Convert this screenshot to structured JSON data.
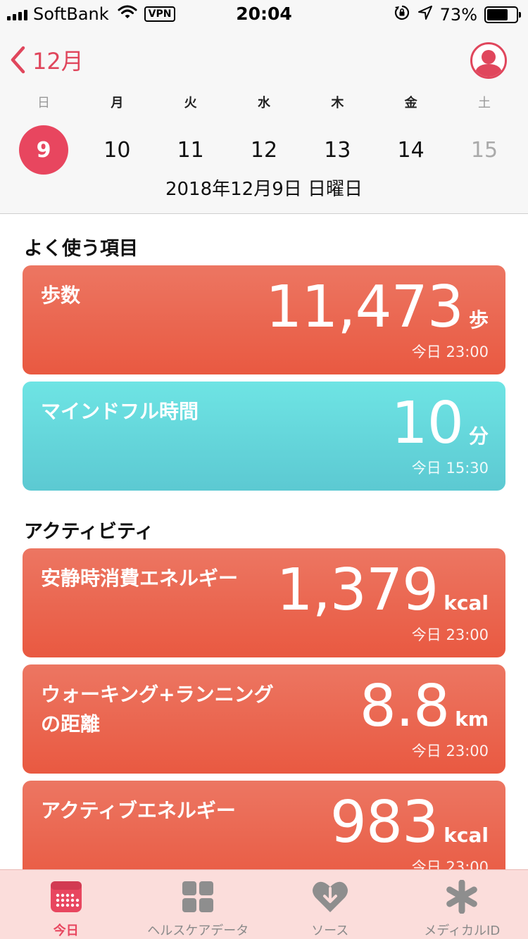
{
  "status_bar": {
    "carrier": "SoftBank",
    "vpn": "VPN",
    "time": "20:04",
    "battery": "73%",
    "battery_level": 0.73
  },
  "header": {
    "back_label": "12月",
    "weekdays": [
      "日",
      "月",
      "火",
      "水",
      "木",
      "金",
      "土"
    ],
    "dates": [
      "9",
      "10",
      "11",
      "12",
      "13",
      "14",
      "15"
    ],
    "selected_date": "9",
    "full_date": "2018年12月9日 日曜日"
  },
  "favorites": {
    "title": "よく使う項目",
    "cards": [
      {
        "title": "歩数",
        "value": "11,473",
        "unit": "歩",
        "timestamp": "今日 23:00",
        "color": "#ea6450"
      },
      {
        "title": "マインドフル時間",
        "value": "10",
        "unit": "分",
        "timestamp": "今日 15:30",
        "color": "#66d8dd"
      }
    ]
  },
  "activity": {
    "title": "アクティビティ",
    "cards": [
      {
        "title": "安静時消費エネルギー",
        "value": "1,379",
        "unit": "kcal",
        "timestamp": "今日 23:00",
        "color": "#ea6450"
      },
      {
        "title": "ウォーキング+ランニングの距離",
        "value": "8.8",
        "unit": "km",
        "timestamp": "今日 23:00",
        "color": "#ea6450"
      },
      {
        "title": "アクティブエネルギー",
        "value": "983",
        "unit": "kcal",
        "timestamp": "今日 23:00",
        "color": "#ea6450"
      }
    ]
  },
  "tab_bar": {
    "tabs": [
      {
        "label": "今日",
        "icon": "calendar-icon",
        "active": true
      },
      {
        "label": "ヘルスケアデータ",
        "icon": "grid-icon",
        "active": false
      },
      {
        "label": "ソース",
        "icon": "heart-download-icon",
        "active": false
      },
      {
        "label": "メディカルID",
        "icon": "asterisk-icon",
        "active": false
      }
    ]
  },
  "colors": {
    "accent": "#e8465f",
    "card_red": "#ea6450",
    "card_teal": "#66d8dd",
    "tab_bar": "#fbdcda"
  }
}
